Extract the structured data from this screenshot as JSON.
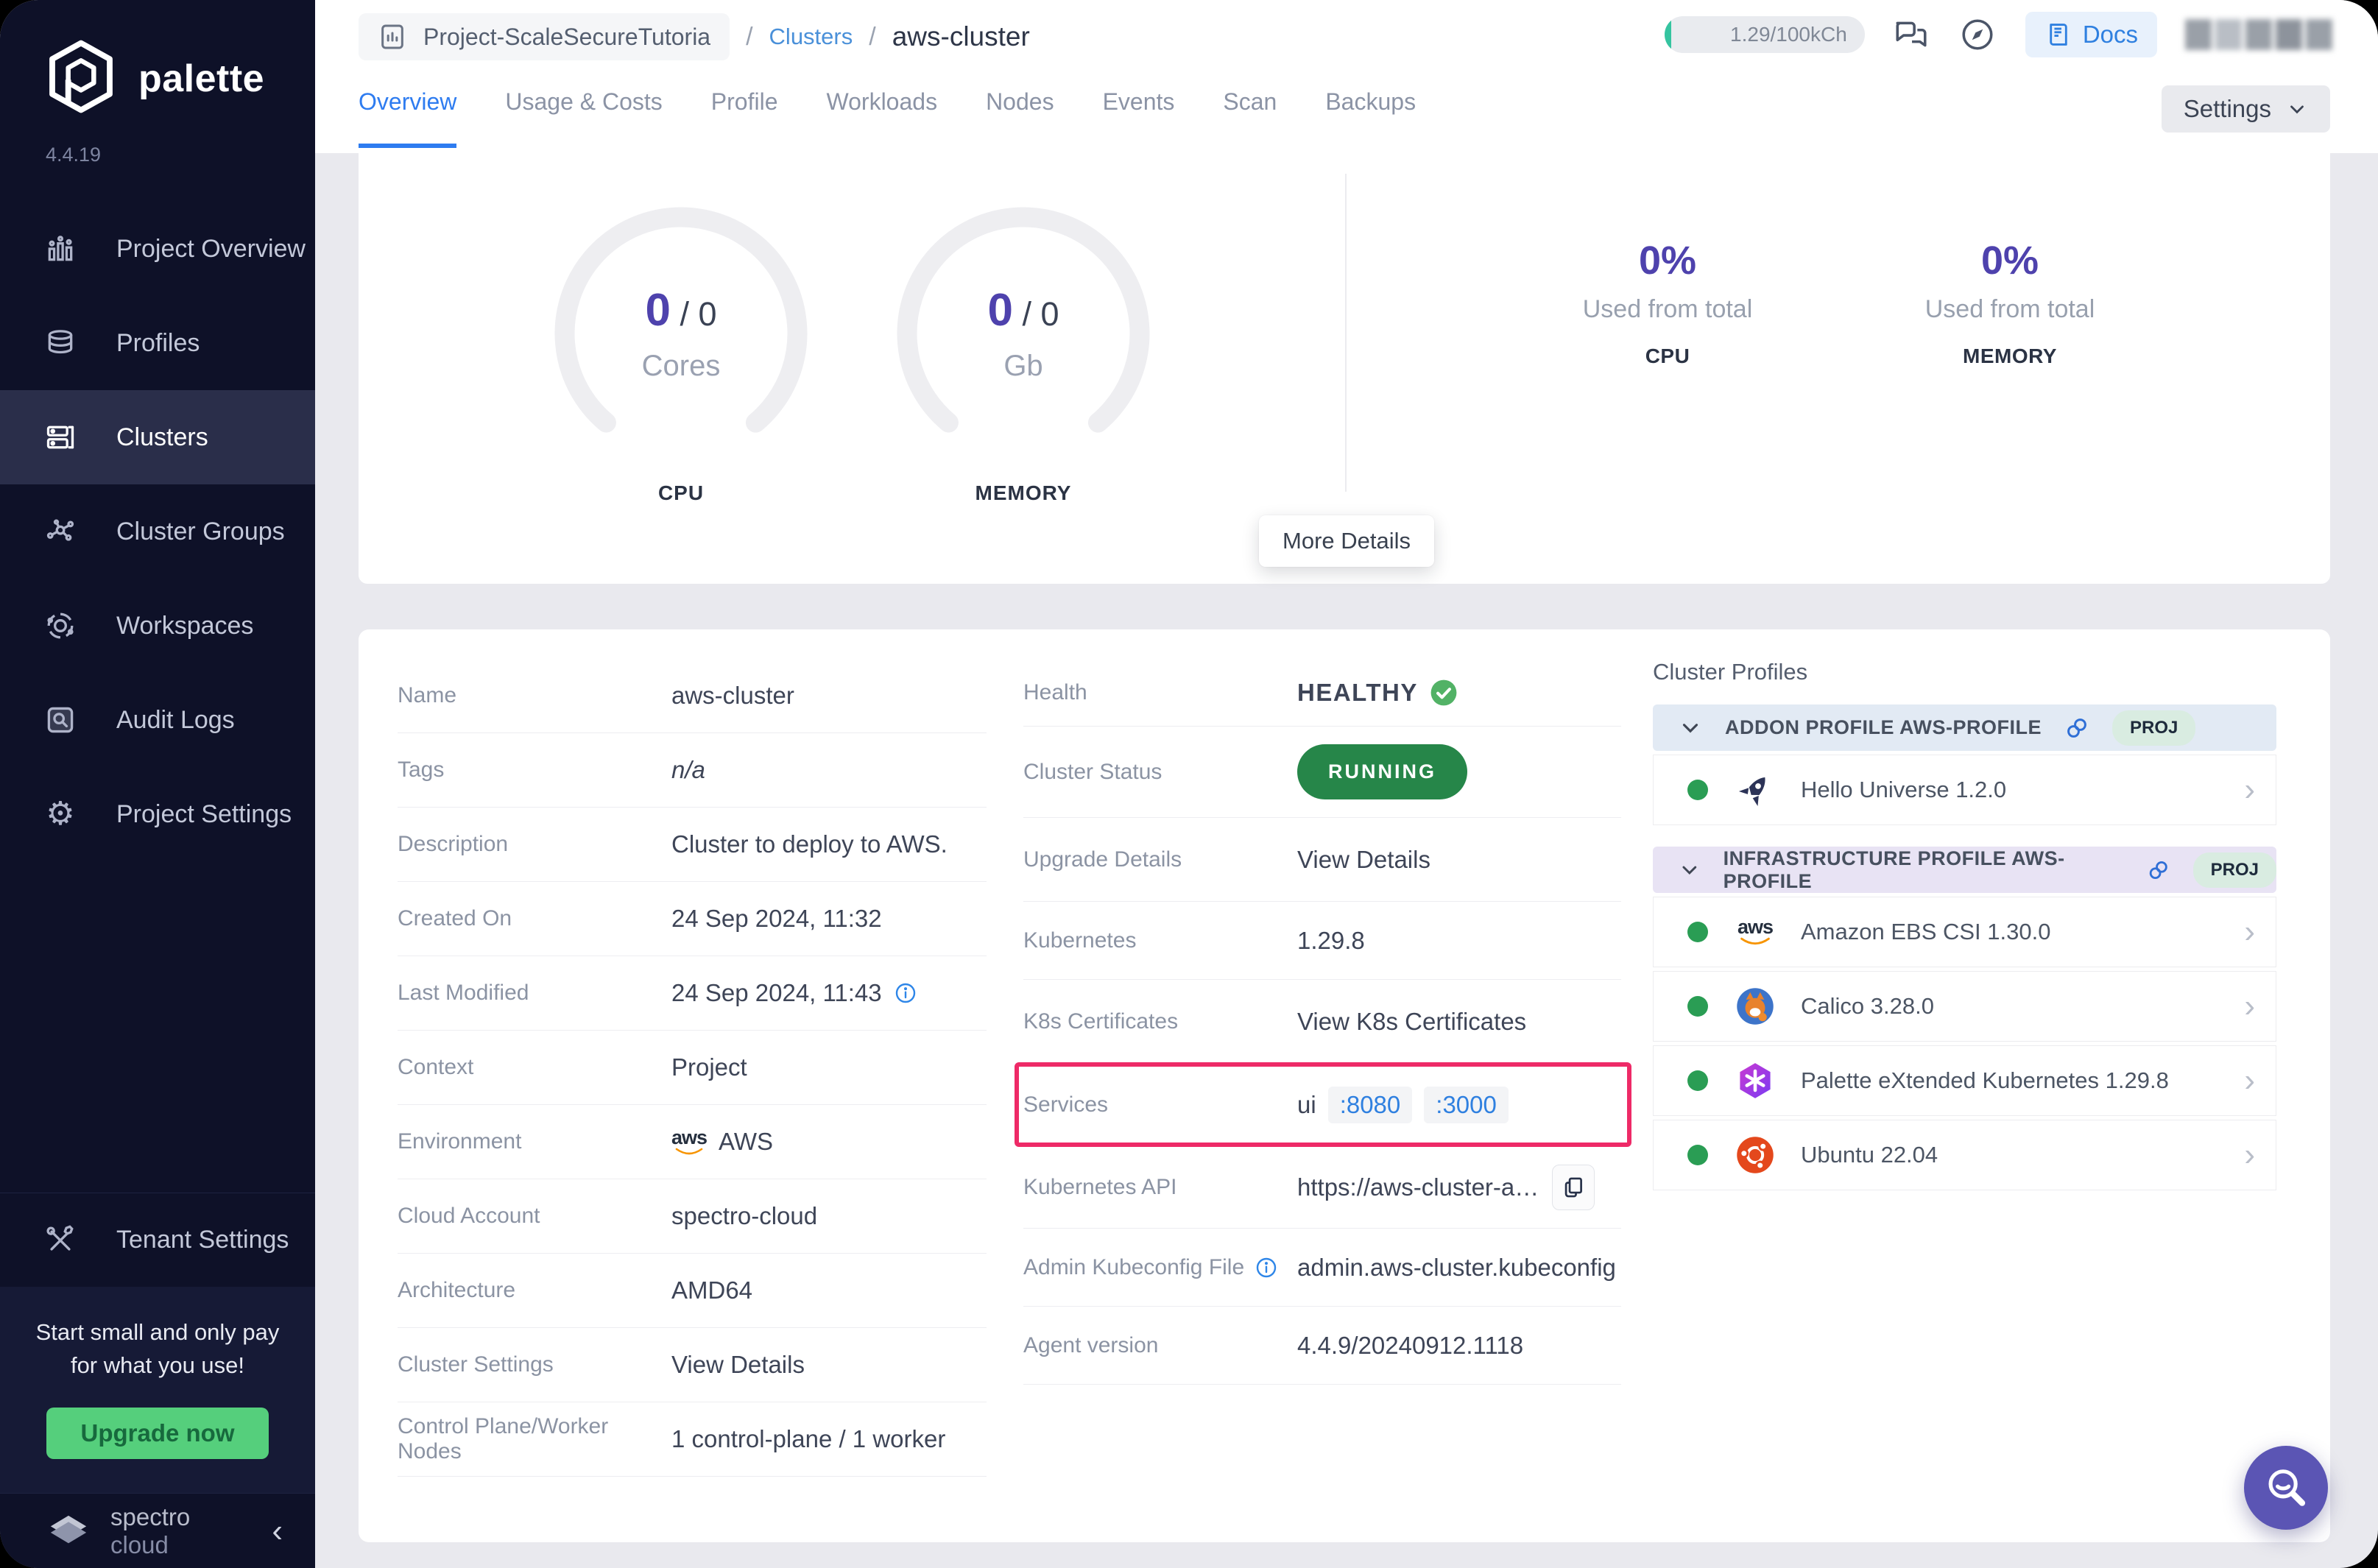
{
  "brand": {
    "name": "palette",
    "version": "4.4.19",
    "footer_regular": "spectro",
    "footer_light": "cloud"
  },
  "sidebar": {
    "items": [
      {
        "label": "Project Overview"
      },
      {
        "label": "Profiles"
      },
      {
        "label": "Clusters"
      },
      {
        "label": "Cluster Groups"
      },
      {
        "label": "Workspaces"
      },
      {
        "label": "Audit Logs"
      },
      {
        "label": "Project Settings"
      }
    ],
    "tenant_label": "Tenant Settings",
    "upsell": {
      "line1": "Start small and only pay",
      "line2": "for what you use!",
      "button": "Upgrade now"
    }
  },
  "header": {
    "project": "Project-ScaleSecureTutoria",
    "sep": "/",
    "clusters_link": "Clusters",
    "cluster_name": "aws-cluster",
    "credits": "1.29/100kCh",
    "docs": "Docs",
    "settings": "Settings"
  },
  "tabs": {
    "items": [
      {
        "label": "Overview"
      },
      {
        "label": "Usage & Costs"
      },
      {
        "label": "Profile"
      },
      {
        "label": "Workloads"
      },
      {
        "label": "Nodes"
      },
      {
        "label": "Events"
      },
      {
        "label": "Scan"
      },
      {
        "label": "Backups"
      }
    ]
  },
  "overview": {
    "cpu_gauge": {
      "used": "0",
      "rest": "/ 0",
      "unit": "Cores",
      "label": "CPU"
    },
    "mem_gauge": {
      "used": "0",
      "rest": "/ 0",
      "unit": "Gb",
      "label": "MEMORY"
    },
    "cpu_usage": {
      "pct": "0%",
      "caption": "Used from total",
      "label": "CPU"
    },
    "mem_usage": {
      "pct": "0%",
      "caption": "Used from total",
      "label": "MEMORY"
    },
    "more_details": "More Details"
  },
  "details": {
    "left": {
      "name": {
        "label": "Name",
        "value": "aws-cluster"
      },
      "tags": {
        "label": "Tags",
        "value": "n/a"
      },
      "description": {
        "label": "Description",
        "value": "Cluster to deploy to AWS."
      },
      "created_on": {
        "label": "Created On",
        "value": "24 Sep 2024, 11:32"
      },
      "last_modified": {
        "label": "Last Modified",
        "value": "24 Sep 2024, 11:43"
      },
      "context": {
        "label": "Context",
        "value": "Project"
      },
      "environment": {
        "label": "Environment",
        "value": "AWS"
      },
      "cloud_account": {
        "label": "Cloud Account",
        "value": "spectro-cloud"
      },
      "architecture": {
        "label": "Architecture",
        "value": "AMD64"
      },
      "cluster_settings": {
        "label": "Cluster Settings",
        "value": "View Details"
      },
      "nodes": {
        "label": "Control Plane/Worker Nodes",
        "value": "1 control-plane / 1 worker"
      }
    },
    "middle": {
      "health": {
        "label": "Health",
        "value": "HEALTHY"
      },
      "status": {
        "label": "Cluster Status",
        "value": "RUNNING"
      },
      "upgrade": {
        "label": "Upgrade Details",
        "value": "View Details"
      },
      "kubernetes": {
        "label": "Kubernetes",
        "value": "1.29.8"
      },
      "certs": {
        "label": "K8s Certificates",
        "value": "View K8s Certificates"
      },
      "services": {
        "label": "Services",
        "name": "ui",
        "ports": [
          ":8080",
          ":3000"
        ]
      },
      "api": {
        "label": "Kubernetes API",
        "value": "https://aws-cluster-apiserve..."
      },
      "kubeconfig": {
        "label": "Admin Kubeconfig File",
        "value": "admin.aws-cluster.kubeconfig"
      },
      "agent": {
        "label": "Agent version",
        "value": "4.4.9/20240912.1118"
      }
    }
  },
  "profiles": {
    "title": "Cluster Profiles",
    "sections": [
      {
        "header": "ADDON PROFILE AWS-PROFILE",
        "badge": "PROJ",
        "items": [
          {
            "name": "Hello Universe 1.2.0"
          }
        ]
      },
      {
        "header": "INFRASTRUCTURE PROFILE AWS-PROFILE",
        "badge": "PROJ",
        "items": [
          {
            "name": "Amazon EBS CSI 1.30.0"
          },
          {
            "name": "Calico 3.28.0"
          },
          {
            "name": "Palette eXtended Kubernetes 1.29.8"
          },
          {
            "name": "Ubuntu 22.04"
          }
        ]
      }
    ]
  },
  "colors": {
    "accent_purple": "#4e42ad",
    "accent_blue": "#2e7cf0",
    "link_blue": "#3e96e6",
    "healthy_green": "#57b368",
    "running_green": "#268649",
    "highlight_pink": "#ee2a67",
    "upgrade_green": "#55cf7c",
    "sidebar_navy": "#0e1128"
  }
}
